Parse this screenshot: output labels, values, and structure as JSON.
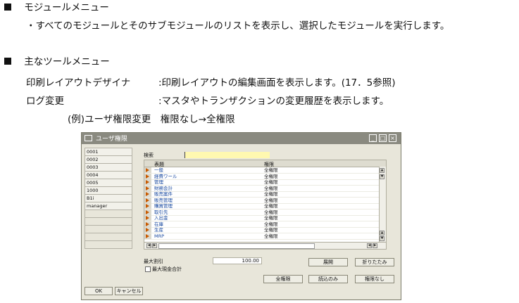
{
  "doc": {
    "h1": "モジュールメニュー",
    "p1": "・すべてのモジュールとそのサブモジュールのリストを表示し、選択したモジュールを実行します。",
    "h2": "主なツールメニュー",
    "r1_label": "印刷レイアウトデザイナ",
    "r1_desc": ":印刷レイアウトの編集画面を表示します。(17．5参照)",
    "r2_label": "ログ変更",
    "r2_desc": ":マスタやトランザクションの変更履歴を表示します。",
    "example": "(例)ユーザ権限変更　権限なし→全権限"
  },
  "window": {
    "title": "ユーザ権限",
    "users": [
      "0001",
      "0002",
      "0003",
      "0004",
      "0005",
      "1000",
      "B1i",
      "manager"
    ],
    "search_label": "検索",
    "search_value": "",
    "col_subject": "表題",
    "col_permission": "権限",
    "rows": [
      {
        "name": "一般",
        "perm": "全権限"
      },
      {
        "name": "経費ワール",
        "perm": "全権限"
      },
      {
        "name": "管理",
        "perm": "全権限"
      },
      {
        "name": "財務会計",
        "perm": "全権限"
      },
      {
        "name": "販売案件",
        "perm": "全権限"
      },
      {
        "name": "販売管理",
        "perm": "全権限"
      },
      {
        "name": "購買管理",
        "perm": "全権限"
      },
      {
        "name": "取引先",
        "perm": "全権限"
      },
      {
        "name": "入出金",
        "perm": "全権限"
      },
      {
        "name": "在庫",
        "perm": "全権限"
      },
      {
        "name": "生産",
        "perm": "全権限"
      },
      {
        "name": "MRP",
        "perm": "全権限"
      }
    ],
    "max_discount_label": "最大割引",
    "max_discount_value": "100.00",
    "max_cash_label": "最大現金合計",
    "btn_expand": "展開",
    "btn_collapse": "折りたたみ",
    "btn_full": "全権限",
    "btn_readonly": "読込のみ",
    "btn_none": "権限なし",
    "btn_ok": "OK",
    "btn_cancel": "キャンセル"
  }
}
